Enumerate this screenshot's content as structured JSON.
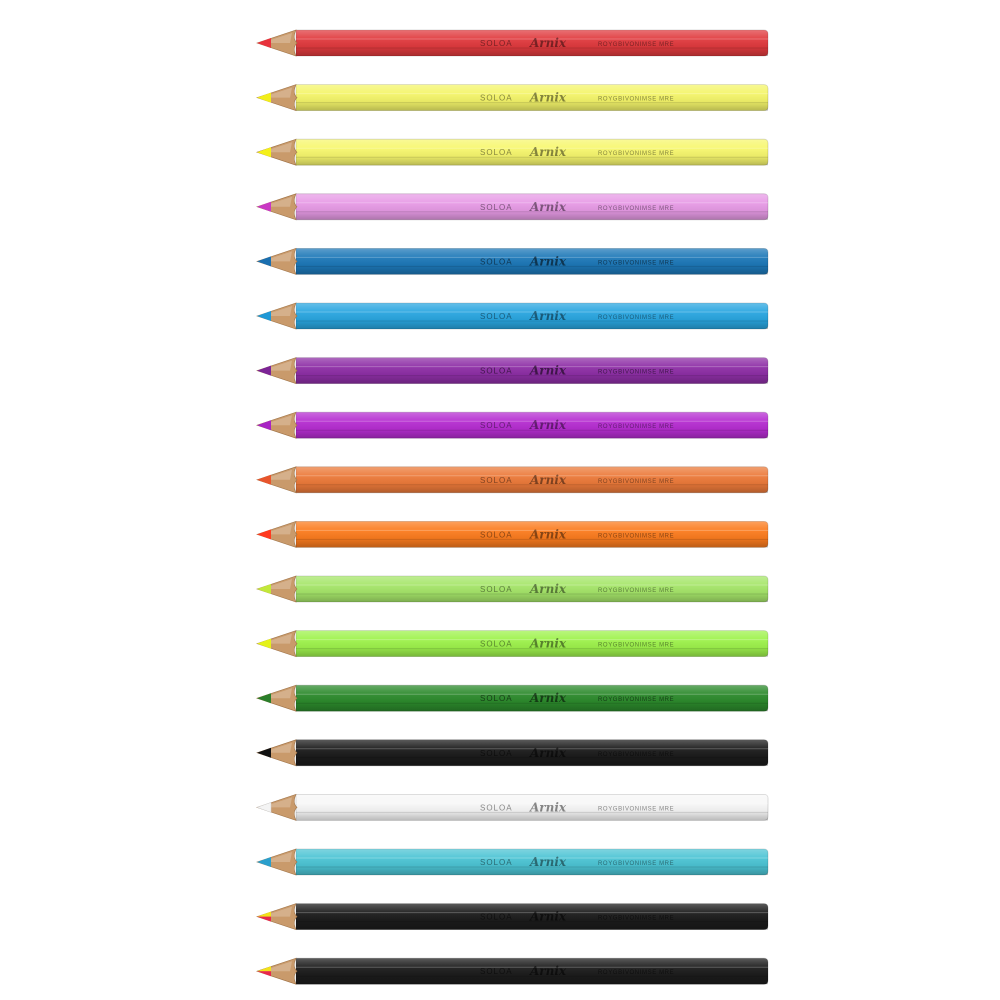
{
  "pencils": [
    {
      "body": "#e03a3e",
      "lead": "#e8323c",
      "lead2": null,
      "brand": "SOLOA",
      "logo": "Arnix",
      "tagline": "ROYGBIVONIMSE MRE"
    },
    {
      "body": "#f4f56a",
      "lead": "#f2ee1a",
      "lead2": null,
      "brand": "SOLOA",
      "logo": "Arnix",
      "tagline": "ROYGBIVONIMSE MRE"
    },
    {
      "body": "#f7f76e",
      "lead": "#f4f01a",
      "lead2": null,
      "brand": "SOLOA",
      "logo": "Arnix",
      "tagline": "ROYGBIVONIMSE MRE"
    },
    {
      "body": "#e79be6",
      "lead": "#c938c4",
      "lead2": null,
      "brand": "SOLOA",
      "logo": "Arnix",
      "tagline": "ROYGBIVONIMSE MRE"
    },
    {
      "body": "#1d78b8",
      "lead": "#1a6fb0",
      "lead2": null,
      "brand": "SOLOA",
      "logo": "Arnix",
      "tagline": "ROYGBIVONIMSE MRE"
    },
    {
      "body": "#2aa6e0",
      "lead": "#1f98d6",
      "lead2": null,
      "brand": "SOLOA",
      "logo": "Arnix",
      "tagline": "ROYGBIVONIMSE MRE"
    },
    {
      "body": "#8e2fa6",
      "lead": "#7c2496",
      "lead2": null,
      "brand": "SOLOA",
      "logo": "Arnix",
      "tagline": "ROYGBIVONIMSE MRE"
    },
    {
      "body": "#b62ed1",
      "lead": "#a824c4",
      "lead2": null,
      "brand": "SOLOA",
      "logo": "Arnix",
      "tagline": "ROYGBIVONIMSE MRE"
    },
    {
      "body": "#ec7a3a",
      "lead": "#e8552c",
      "lead2": null,
      "brand": "SOLOA",
      "logo": "Arnix",
      "tagline": "ROYGBIVONIMSE MRE"
    },
    {
      "body": "#fb7c1f",
      "lead": "#ff3a1f",
      "lead2": null,
      "brand": "SOLOA",
      "logo": "Arnix",
      "tagline": "ROYGBIVONIMSE MRE"
    },
    {
      "body": "#a6e66a",
      "lead": "#c2e83a",
      "lead2": null,
      "brand": "SOLOA",
      "logo": "Arnix",
      "tagline": "ROYGBIVONIMSE MRE"
    },
    {
      "body": "#9ef24c",
      "lead": "#e4f21a",
      "lead2": null,
      "brand": "SOLOA",
      "logo": "Arnix",
      "tagline": "ROYGBIVONIMSE MRE"
    },
    {
      "body": "#2c8a2c",
      "lead": "#2a7e2a",
      "lead2": null,
      "brand": "SOLOA",
      "logo": "Arnix",
      "tagline": "ROYGBIVONIMSE MRE"
    },
    {
      "body": "#1b1b1b",
      "lead": "#111111",
      "lead2": null,
      "brand": "SOLOA",
      "logo": "Arnix",
      "tagline": "ROYGBIVONIMSE MRE"
    },
    {
      "body": "#f7f7f7",
      "lead": "#f4f4f4",
      "lead2": null,
      "brand": "SOLOA",
      "logo": "Arnix",
      "tagline": "ROYGBIVONIMSE MRE"
    },
    {
      "body": "#4cc4d4",
      "lead": "#2a9fcc",
      "lead2": null,
      "brand": "SOLOA",
      "logo": "Arnix",
      "tagline": "ROYGBIVONIMSE MRE"
    },
    {
      "body": "#1c1c1c",
      "lead": "#f2e21a",
      "lead2": "#e8284c",
      "brand": "SOLOA",
      "logo": "Arnix",
      "tagline": "ROYGBIVONIMSE MRE"
    },
    {
      "body": "#1c1c1c",
      "lead": "#f2e21a",
      "lead2": "#e8284c",
      "brand": "SOLOA",
      "logo": "Arnix",
      "tagline": "ROYGBIVONIMSE MRE"
    }
  ]
}
